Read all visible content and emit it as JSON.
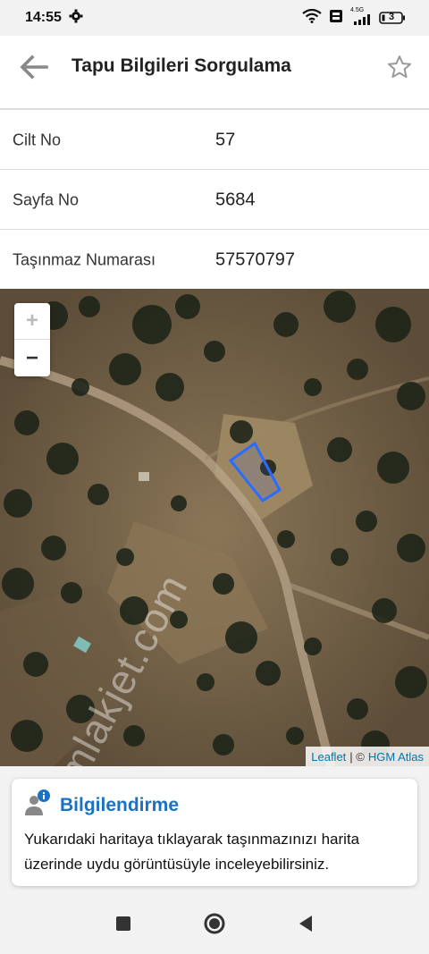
{
  "status": {
    "time": "14:55",
    "network": "4.5G",
    "battery": "3"
  },
  "header": {
    "title": "Tapu Bilgileri Sorgulama"
  },
  "details": [
    {
      "label": "Cilt No",
      "value": "57"
    },
    {
      "label": "Sayfa No",
      "value": "5684"
    },
    {
      "label": "Taşınmaz Numarası",
      "value": "57570797"
    }
  ],
  "map": {
    "zoom_in": "+",
    "zoom_out": "−",
    "attribution_leaflet": "Leaflet",
    "attribution_sep": "| ©",
    "attribution_source": "HGM Atlas",
    "watermark": "emlakjet.com"
  },
  "info": {
    "title": "Bilgilendirme",
    "text": "Yukarıdaki haritaya tıklayarak taşınmazınızı harita üzerinde uydu görüntüsüyle inceleyebilirsiniz."
  },
  "colors": {
    "accent": "#1a72c2",
    "parcel": "#2a6cff"
  }
}
